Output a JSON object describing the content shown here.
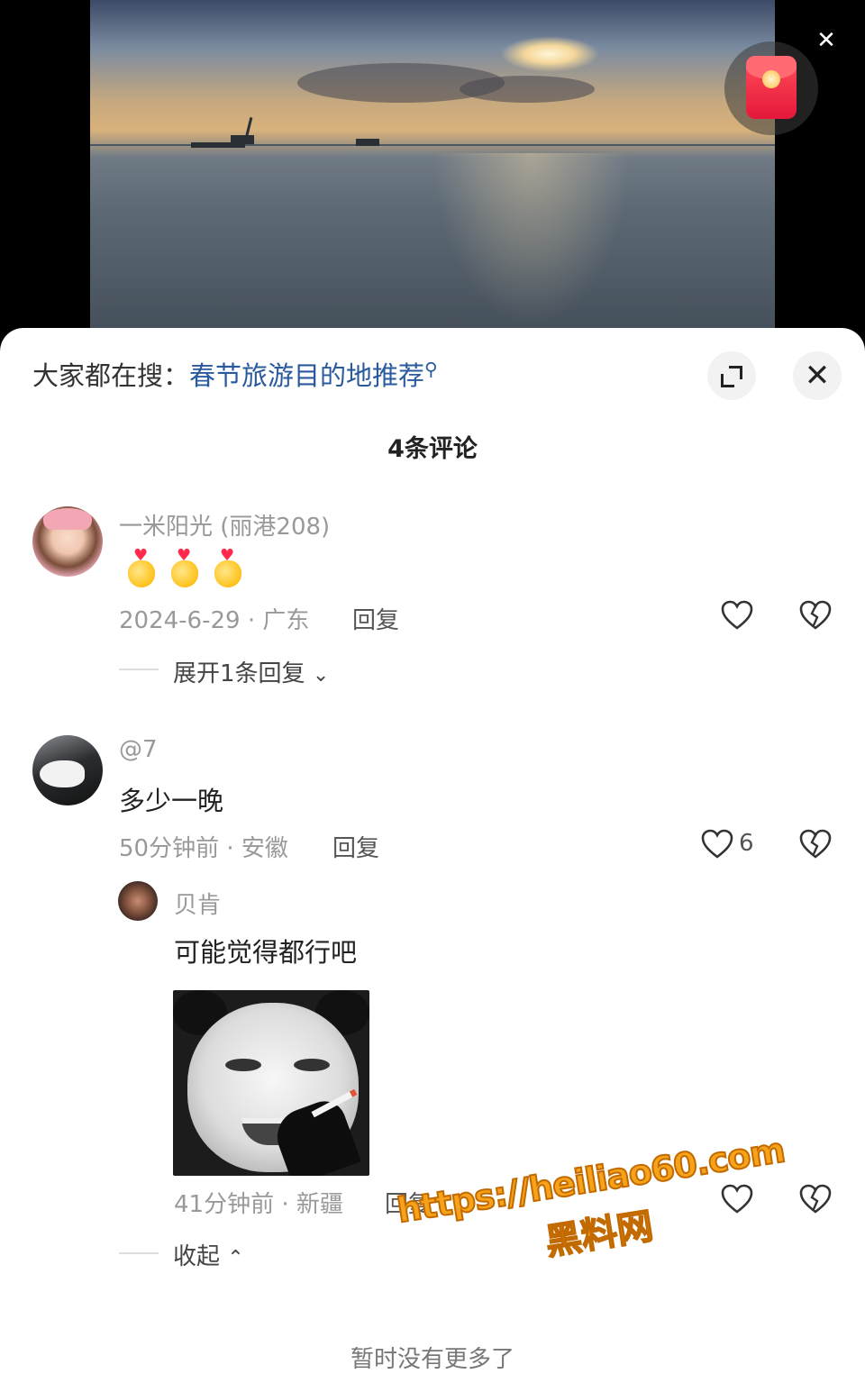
{
  "top": {
    "close_icon": "close-icon",
    "red_packet_icon": "red-packet-icon"
  },
  "search_bar": {
    "prefix": "大家都在搜：",
    "hot_query": "春节旅游目的地推荐",
    "expand_icon": "expand-icon",
    "close_icon": "close-icon"
  },
  "comments_header": {
    "count_label": "4条评论"
  },
  "comments": [
    {
      "user": "一米阳光 (丽港208)",
      "emoji": [
        "finger-heart",
        "finger-heart",
        "finger-heart"
      ],
      "time_location": "2024-6-29 · 广东",
      "reply_label": "回复",
      "expand_label": "展开1条回复"
    },
    {
      "user": "@7",
      "text": "多少一晚",
      "time_location": "50分钟前 · 安徽",
      "reply_label": "回复",
      "likes": "6",
      "replies": [
        {
          "user": "贝肯",
          "text": "可能觉得都行吧",
          "sticker": "panda-meme",
          "time_location": "41分钟前 · 新疆",
          "reply_label": "回复"
        }
      ],
      "collapse_label": "收起"
    }
  ],
  "footer": {
    "no_more": "暂时没有更多了"
  },
  "watermark": {
    "url": "https://heiliao60.com",
    "site": "黑料网"
  },
  "colors": {
    "accent_link": "#2a5a9e",
    "watermark": "#f7a21b",
    "red_packet": "#e5183a"
  }
}
